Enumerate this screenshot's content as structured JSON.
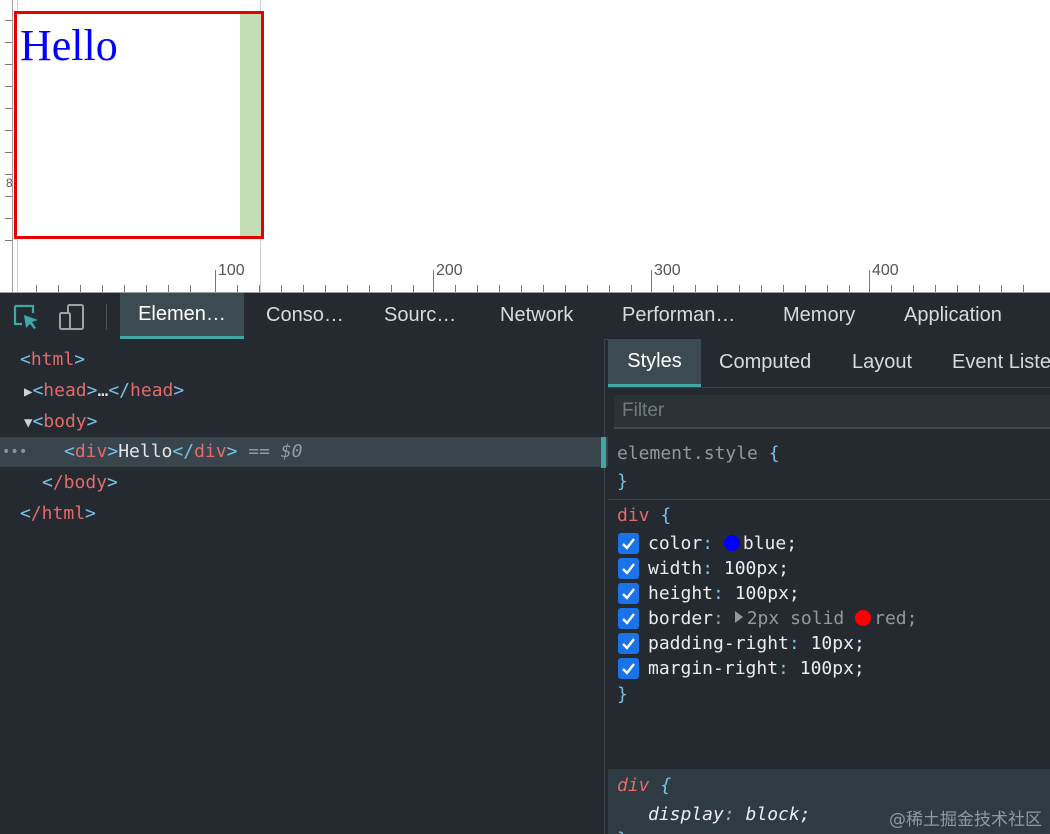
{
  "viewport": {
    "demo_text": "Hello",
    "v_ruler_label": "8",
    "h_ruler_labels": [
      "100",
      "200",
      "300",
      "400"
    ]
  },
  "devtools": {
    "tabs": [
      {
        "label": "Elemen…",
        "active": true
      },
      {
        "label": "Conso…"
      },
      {
        "label": "Sourc…"
      },
      {
        "label": "Network"
      },
      {
        "label": "Performan…"
      },
      {
        "label": "Memory"
      },
      {
        "label": "Application"
      }
    ],
    "dom": {
      "html_open": "html",
      "head": "head",
      "head_ellipsis": "…",
      "body_open": "body",
      "div_tag": "div",
      "div_text": "Hello",
      "selected_ref": "== $0",
      "body_close": "/body",
      "html_close": "/html"
    },
    "styles": {
      "subtabs": [
        {
          "label": "Styles",
          "active": true
        },
        {
          "label": "Computed"
        },
        {
          "label": "Layout"
        },
        {
          "label": "Event Liste"
        }
      ],
      "filter_placeholder": "Filter",
      "element_style_selector": "element.style",
      "rule_selector": "div",
      "declarations": [
        {
          "prop": "color",
          "value": "blue",
          "swatch": "#0000ff"
        },
        {
          "prop": "width",
          "value": "100px"
        },
        {
          "prop": "height",
          "value": "100px"
        },
        {
          "prop": "border",
          "value_pre": "2px solid",
          "value": "red",
          "swatch": "#ff0000"
        },
        {
          "prop": "padding-right",
          "value": "10px"
        },
        {
          "prop": "margin-right",
          "value": "100px"
        }
      ],
      "ua_selector": "div",
      "ua_prop": "display",
      "ua_value": "block"
    },
    "watermark": "@稀土掘金技术社区"
  }
}
